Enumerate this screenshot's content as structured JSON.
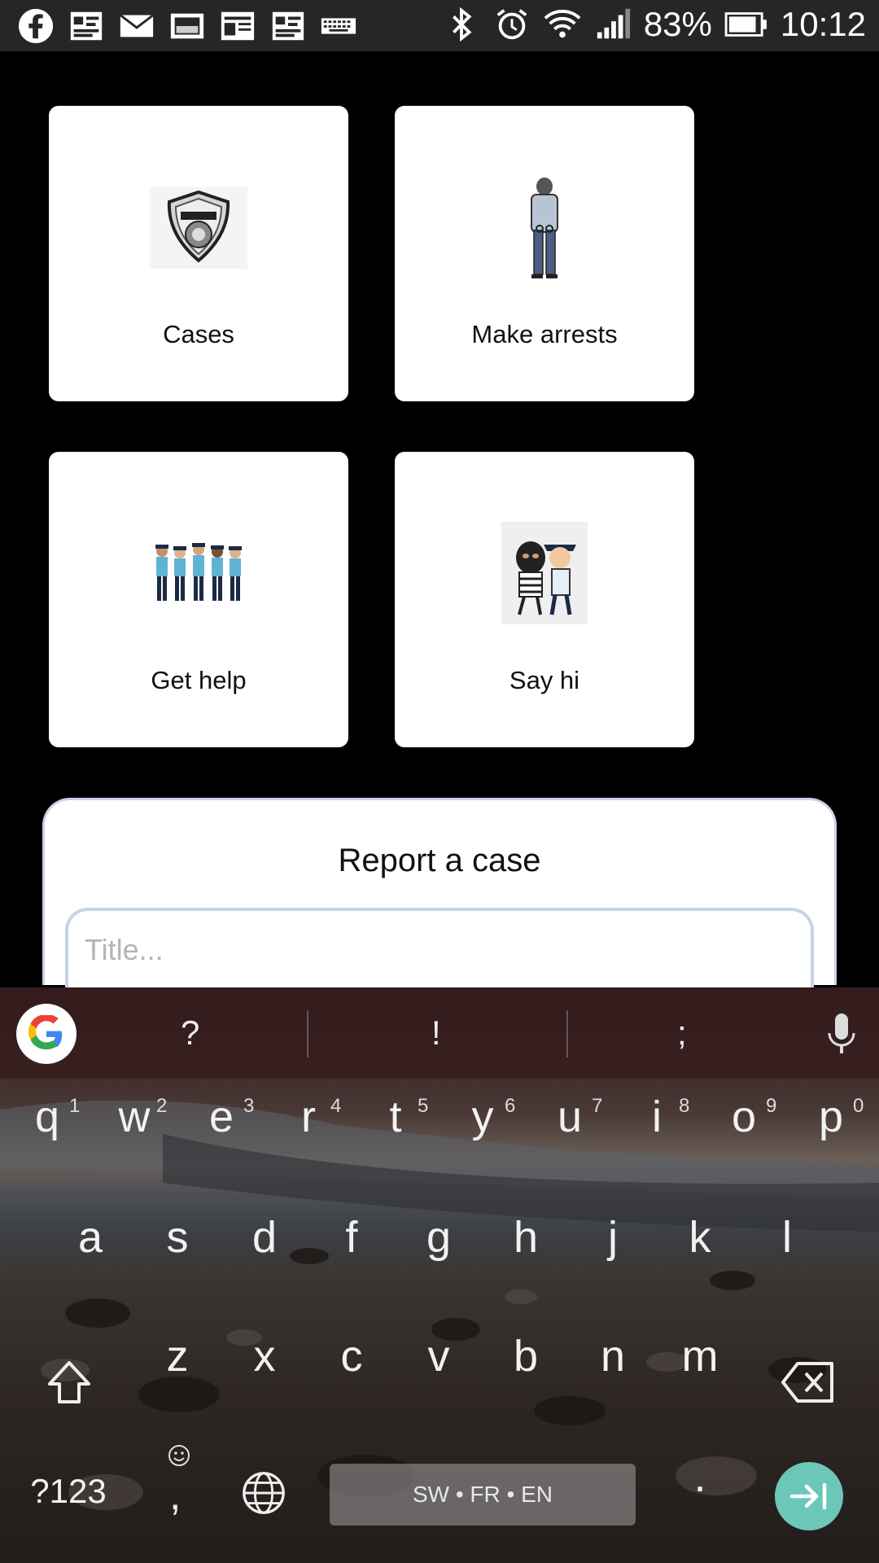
{
  "status_bar": {
    "battery": "83%",
    "time": "10:12"
  },
  "tiles": [
    {
      "label": "Cases",
      "icon": "police-badge-icon"
    },
    {
      "label": "Make arrests",
      "icon": "handcuffed-man-icon"
    },
    {
      "label": "Get help",
      "icon": "police-officers-group-icon"
    },
    {
      "label": "Say hi",
      "icon": "police-and-thief-icon"
    }
  ],
  "report": {
    "title": "Report a case",
    "title_placeholder": "Title..."
  },
  "keyboard": {
    "suggestions": [
      "?",
      "!",
      ";"
    ],
    "row1": [
      "q",
      "w",
      "e",
      "r",
      "t",
      "y",
      "u",
      "i",
      "o",
      "p"
    ],
    "row1_numbers": [
      "1",
      "2",
      "3",
      "4",
      "5",
      "6",
      "7",
      "8",
      "9",
      "0"
    ],
    "row2": [
      "a",
      "s",
      "d",
      "f",
      "g",
      "h",
      "j",
      "k",
      "l"
    ],
    "row3": [
      "z",
      "x",
      "c",
      "v",
      "b",
      "n",
      "m"
    ],
    "symbols_key": "?123",
    "comma_key": ",",
    "period_key": ".",
    "space_label": "SW • FR • EN"
  },
  "colors": {
    "tile_bg": "#ffffff",
    "card_border": "#c9d3e6",
    "enter_key": "#6cc7b8"
  }
}
